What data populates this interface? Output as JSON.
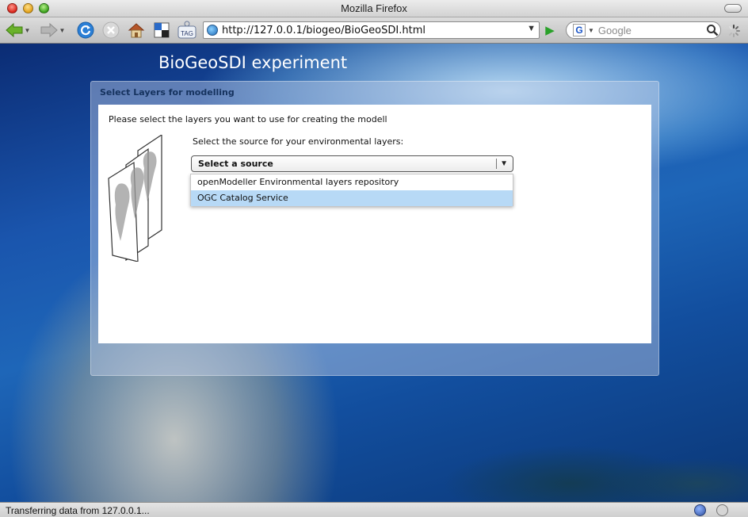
{
  "window": {
    "title": "Mozilla Firefox"
  },
  "toolbar": {
    "url": "http://127.0.0.1/biogeo/BioGeoSDI.html",
    "search_engine_letter": "G",
    "search_placeholder": "Google",
    "icons": [
      "back-arrow-icon",
      "forward-arrow-icon",
      "reload-icon",
      "stop-icon",
      "home-icon",
      "bookmark-icon",
      "tag-icon",
      "globe-icon",
      "go-arrow-icon",
      "search-icon",
      "spinner-icon"
    ],
    "tag_label": "TAG"
  },
  "page": {
    "app_title": "BioGeoSDI experiment",
    "panel_title": "Select Layers for modelling",
    "intro": "Please select the layers you want to use for creating the modell",
    "source_label": "Select the source for your environmental layers:",
    "combo_value": "Select a source",
    "options": [
      {
        "label": "openModeller Environmental layers repository"
      },
      {
        "label": "OGC Catalog Service"
      }
    ],
    "highlighted_option_index": 1,
    "image_name": "stacked-layers-map-image"
  },
  "status": {
    "text": "Transferring data from 127.0.0.1..."
  },
  "colors": {
    "dropdown_highlight": "#b7d9f6",
    "panel_header_text": "#15325e"
  }
}
